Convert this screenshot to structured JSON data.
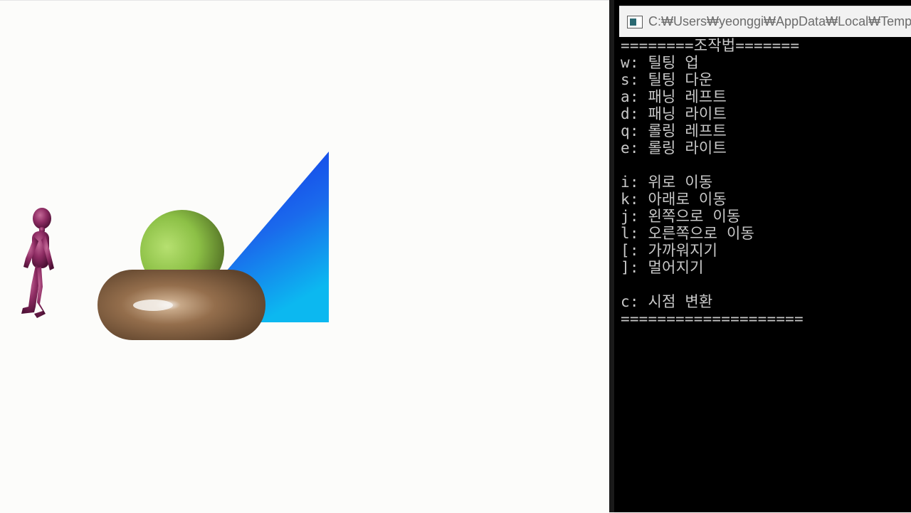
{
  "console_window": {
    "title": "C:₩Users₩yeonggi₩AppData₩Local₩Temp₩B",
    "icon": "console-app-icon",
    "lines": [
      "========조작법=======",
      "w: 틸팅 업",
      "s: 틸팅 다운",
      "a: 패닝 레프트",
      "d: 패닝 라이트",
      "q: 롤링 레프트",
      "e: 롤링 라이트",
      "",
      "i: 위로 이동",
      "k: 아래로 이동",
      "j: 왼쪽으로 이동",
      "l: 오른쪽으로 이동",
      "[: 가까워지기",
      "]: 멀어지기",
      "",
      "c: 시점 변환",
      "===================="
    ]
  },
  "scene": {
    "background": "#fcfcfa",
    "figure_color": "#8e2c63",
    "sphere_color": "#8fc24a",
    "torus_color": "#8a6a4a",
    "cone_colors": [
      "#1436e6",
      "#10b4ee"
    ]
  }
}
